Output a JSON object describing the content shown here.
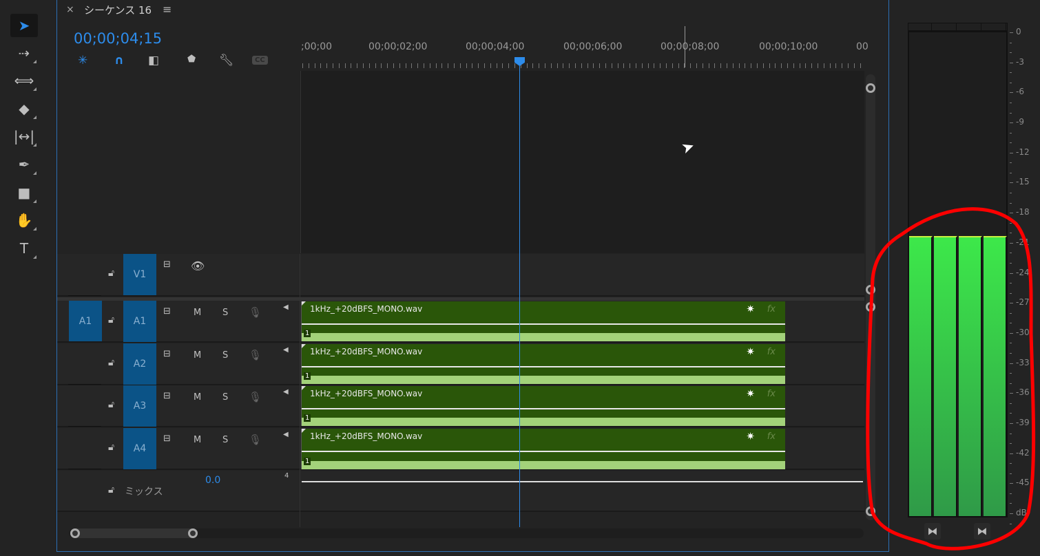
{
  "tools": [
    {
      "name": "selection-tool",
      "glyph": "➤",
      "selected": true
    },
    {
      "name": "track-select-forward-tool",
      "glyph": "⇢"
    },
    {
      "name": "ripple-edit-tool",
      "glyph": "⟺"
    },
    {
      "name": "razor-tool",
      "glyph": "◆"
    },
    {
      "name": "slip-tool",
      "glyph": "|↔|"
    },
    {
      "name": "pen-tool",
      "glyph": "✒"
    },
    {
      "name": "rectangle-tool",
      "glyph": "■"
    },
    {
      "name": "hand-tool",
      "glyph": "✋"
    },
    {
      "name": "type-tool",
      "glyph": "T"
    }
  ],
  "panel": {
    "close": "×",
    "title": "シーケンス 16",
    "menu": "≡",
    "timecode": "00;00;04;15",
    "accent": "#2d8ceb"
  },
  "ruler": {
    "labels": [
      ";00;00",
      "00;00;02;00",
      "00;00;04;00",
      "00;00;06;00",
      "00;00;08;00",
      "00;00;10;00",
      "00"
    ]
  },
  "video_tracks": [
    {
      "label": "V1"
    }
  ],
  "audio_tracks": [
    {
      "source": "A1",
      "label": "A1",
      "mute": "M",
      "solo": "S",
      "clip": "1kHz_+20dBFS_MONO.wav",
      "channel": "1"
    },
    {
      "source": "",
      "label": "A2",
      "mute": "M",
      "solo": "S",
      "clip": "1kHz_+20dBFS_MONO.wav",
      "channel": "1"
    },
    {
      "source": "",
      "label": "A3",
      "mute": "M",
      "solo": "S",
      "clip": "1kHz_+20dBFS_MONO.wav",
      "channel": "1"
    },
    {
      "source": "",
      "label": "A4",
      "mute": "M",
      "solo": "S",
      "clip": "1kHz_+20dBFS_MONO.wav",
      "channel": "1"
    }
  ],
  "mix": {
    "label": "ミックス",
    "value": "0.0",
    "channels": "4"
  },
  "clip_icons": {
    "star": "✷",
    "fx": "fx"
  },
  "meter": {
    "scale": [
      "0",
      "-3",
      "-6",
      "-9",
      "-12",
      "-15",
      "-18",
      "-21",
      "-24",
      "-27",
      "-30",
      "-33",
      "-36",
      "-39",
      "-42",
      "-45",
      "dB"
    ],
    "channels": 4,
    "level_db": [
      -20.3,
      -20.3,
      -20.3,
      -20.3
    ],
    "solo_icon": "⧓"
  }
}
